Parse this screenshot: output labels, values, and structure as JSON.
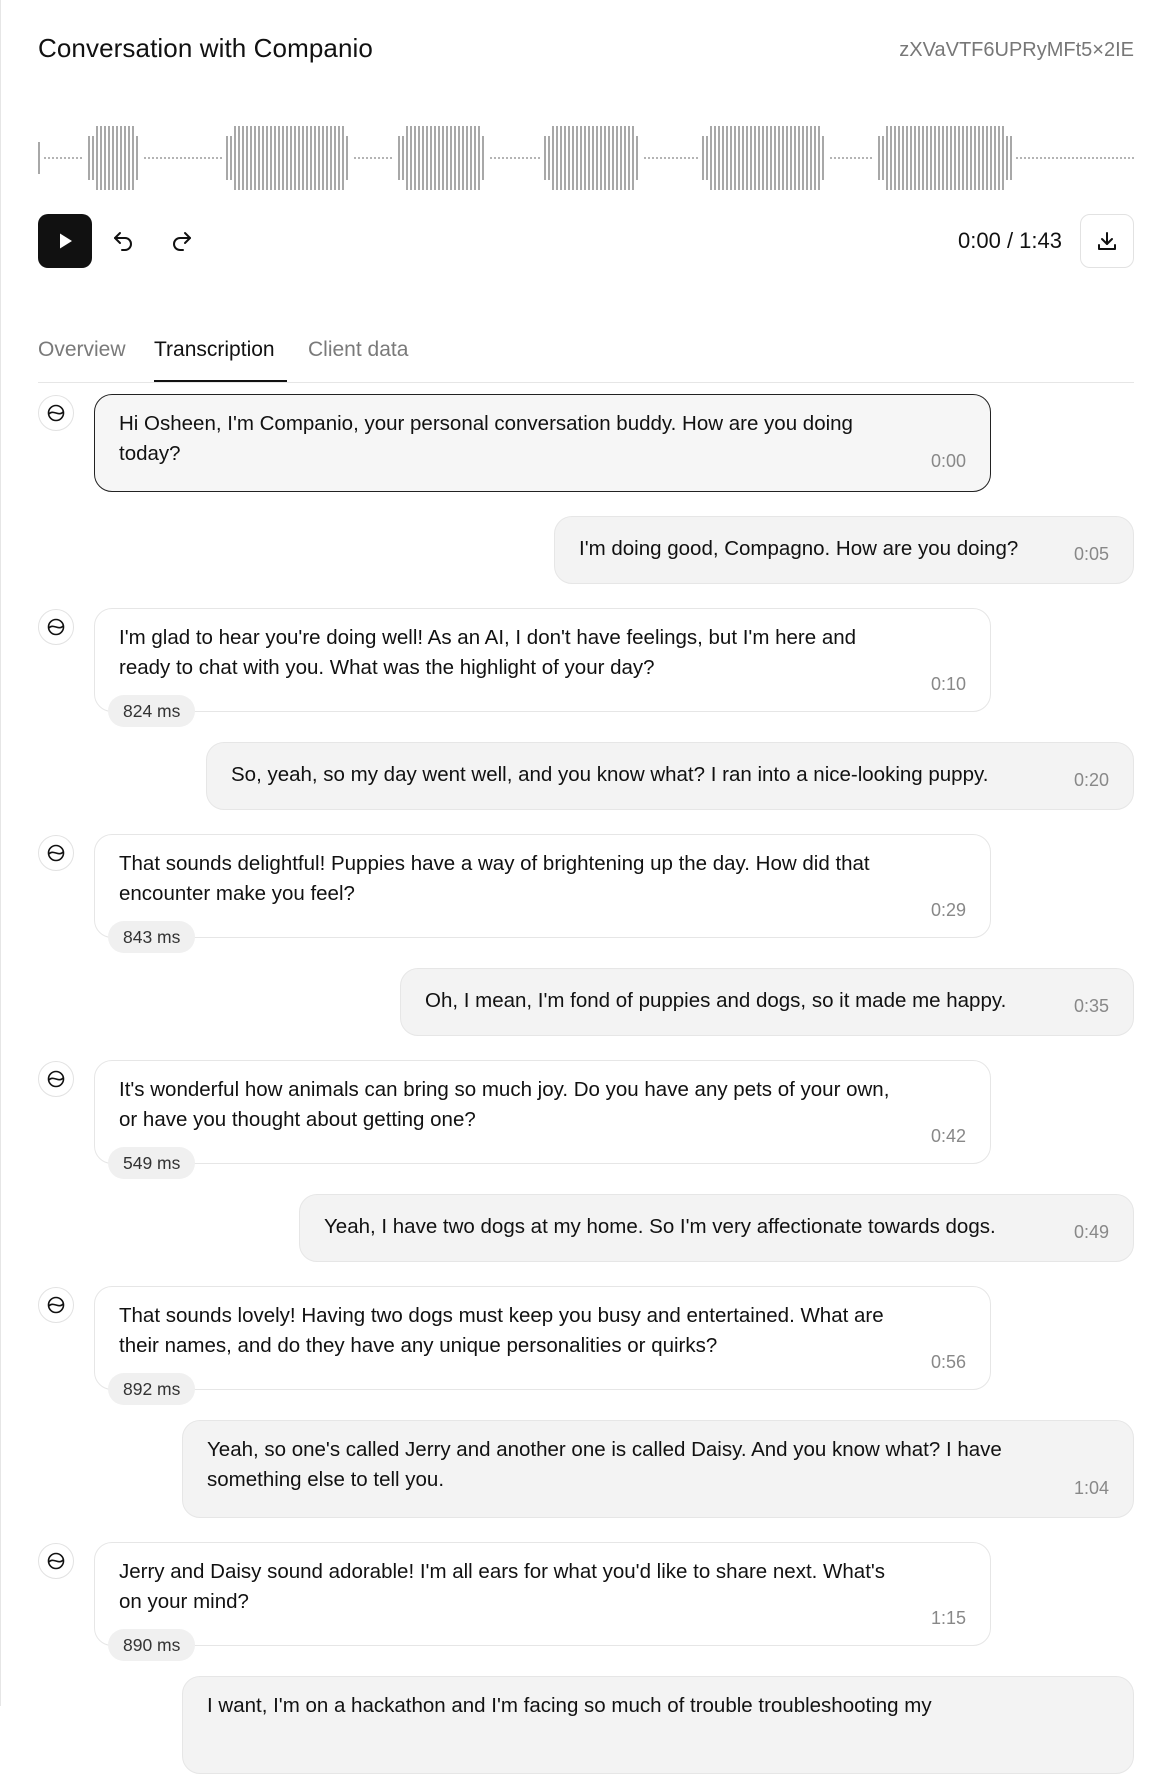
{
  "header": {
    "title": "Conversation with Companio",
    "conversation_id": "zXVaVTF6UPRyMFt5×2IE"
  },
  "player": {
    "time": "0:00 / 1:43"
  },
  "tabs": [
    {
      "label": "Overview",
      "active": false
    },
    {
      "label": "Transcription",
      "active": true
    },
    {
      "label": "Client data",
      "active": false
    }
  ],
  "transcript": [
    {
      "role": "agent",
      "text": "Hi Osheen, I'm Companio, your personal conversation buddy. How are you doing today?",
      "time": "0:00"
    },
    {
      "role": "user",
      "text": "I'm doing good, Compagno. How are you doing?",
      "time": "0:05"
    },
    {
      "role": "agent",
      "text": "I'm glad to hear you're doing well! As an AI, I don't have feelings, but I'm here and ready to chat with you. What was the highlight of your day?",
      "time": "0:10",
      "latency": "824 ms"
    },
    {
      "role": "user",
      "text": "So, yeah, so my day went well, and you know what? I ran into a nice-looking puppy.",
      "time": "0:20"
    },
    {
      "role": "agent",
      "text": "That sounds delightful! Puppies have a way of brightening up the day. How did that encounter make you feel?",
      "time": "0:29",
      "latency": "843 ms"
    },
    {
      "role": "user",
      "text": "Oh, I mean, I'm fond of puppies and dogs, so it made me happy.",
      "time": "0:35"
    },
    {
      "role": "agent",
      "text": "It's wonderful how animals can bring so much joy. Do you have any pets of your own, or have you thought about getting one?",
      "time": "0:42",
      "latency": "549 ms"
    },
    {
      "role": "user",
      "text": "Yeah, I have two dogs at my home. So I'm very affectionate towards dogs.",
      "time": "0:49"
    },
    {
      "role": "agent",
      "text": "That sounds lovely! Having two dogs must keep you busy and entertained. What are their names, and do they have any unique personalities or quirks?",
      "time": "0:56",
      "latency": "892 ms"
    },
    {
      "role": "user",
      "text": "Yeah, so one's called Jerry and another one is called Daisy. And you know what? I have something else to tell you.",
      "time": "1:04"
    },
    {
      "role": "agent",
      "text": "Jerry and Daisy sound adorable! I'm all ears for what you'd like to share next. What's on your mind?",
      "time": "1:15",
      "latency": "890 ms"
    },
    {
      "role": "user",
      "text": "I want, I'm on a hackathon and I'm facing so much of trouble troubleshooting my",
      "time": ""
    }
  ]
}
